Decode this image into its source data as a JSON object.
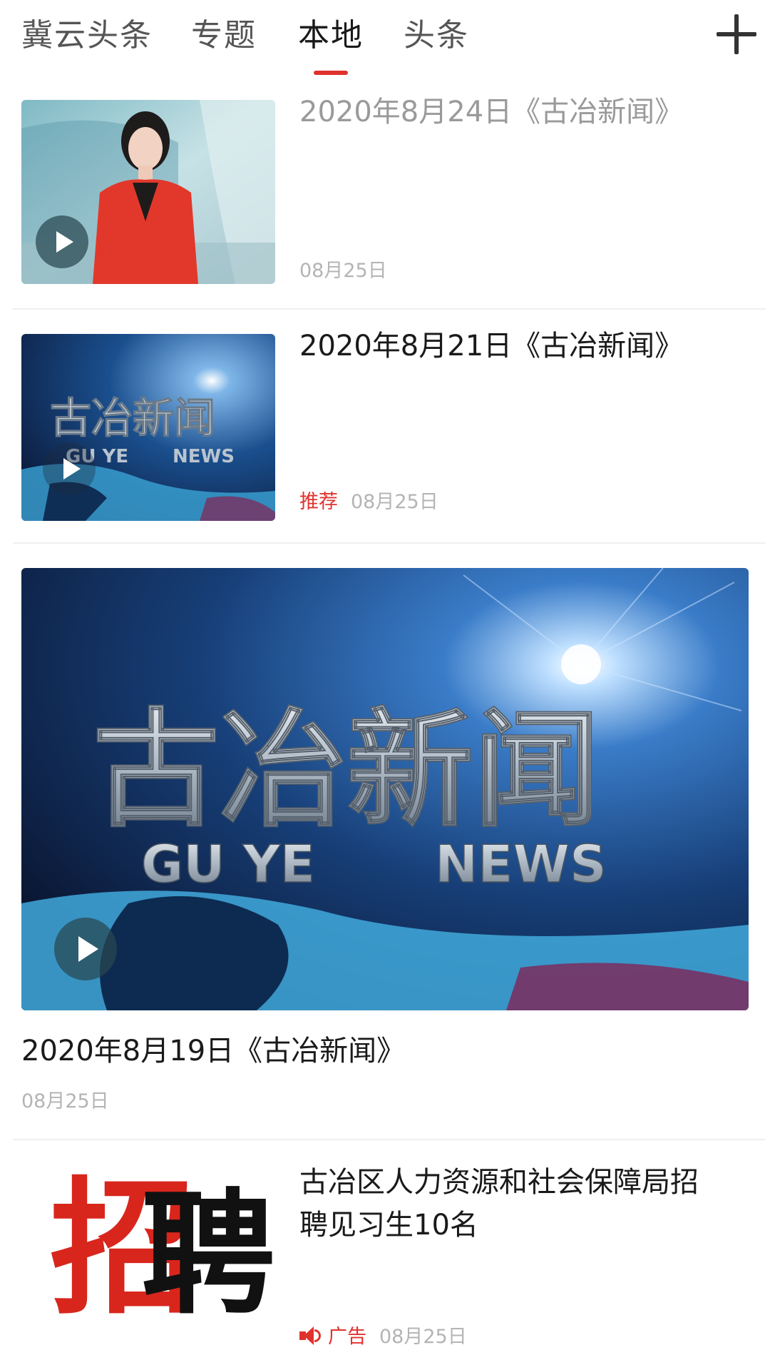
{
  "tabs": [
    {
      "label": "冀云头条",
      "active": false
    },
    {
      "label": "专题",
      "active": false
    },
    {
      "label": "本地",
      "active": true
    },
    {
      "label": "头条",
      "active": false
    }
  ],
  "add_channel_icon": "plus-icon",
  "colors": {
    "accent": "#e0322d",
    "read_title": "#9a9a9a",
    "meta": "#b4b4b4"
  },
  "feed": [
    {
      "title": "2020年8月24日《古冶新闻》",
      "date": "08月25日",
      "read": true,
      "has_video": true,
      "thumb": "news-anchor"
    },
    {
      "title": "2020年8月21日《古冶新闻》",
      "tag": "推荐",
      "date": "08月25日",
      "read": false,
      "has_video": true,
      "thumb": "guye-news-logo"
    },
    {
      "title": "2020年8月19日《古冶新闻》",
      "date": "08月25日",
      "read": false,
      "has_video": true,
      "thumb": "guye-news-logo-large",
      "logo_text": {
        "cn": "古冶新闻",
        "en_left": "GU YE",
        "en_right": "NEWS"
      }
    },
    {
      "title_line1": "古冶区人力资源和社会保障局招",
      "title_line2": "聘见习生10名",
      "tag": "广告",
      "date": "08月25日",
      "thumb": "recruit",
      "recruit_chars": {
        "left": "招",
        "right": "聘"
      }
    }
  ]
}
